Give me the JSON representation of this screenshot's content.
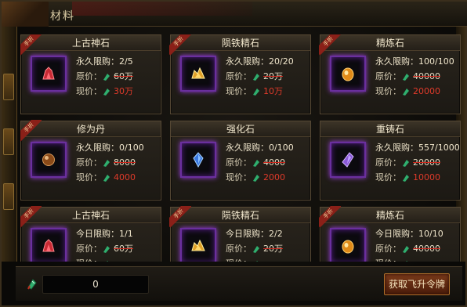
{
  "window": {
    "title": "材料"
  },
  "cards": [
    {
      "name": "上古神石",
      "badge": "手折",
      "limit": "永久限购：2/5",
      "orig_label": "原价：",
      "orig_price": "60万",
      "now_label": "现价：",
      "now_price": "30万",
      "gem": "red-crystal-icon"
    },
    {
      "name": "陨铁精石",
      "badge": "手折",
      "limit": "永久限购：20/20",
      "orig_label": "原价：",
      "orig_price": "20万",
      "now_label": "现价：",
      "now_price": "10万",
      "gem": "gold-ore-icon"
    },
    {
      "name": "精炼石",
      "badge": "手折",
      "limit": "永久限购：100/100",
      "orig_label": "原价：",
      "orig_price": "40000",
      "now_label": "现价：",
      "now_price": "20000",
      "gem": "amber-stone-icon"
    },
    {
      "name": "修为丹",
      "badge": "手折",
      "limit": "永久限购：0/100",
      "orig_label": "原价：",
      "orig_price": "8000",
      "now_label": "现价：",
      "now_price": "4000",
      "gem": "brown-pill-icon"
    },
    {
      "name": "强化石",
      "badge": "",
      "limit": "永久限购：0/100",
      "orig_label": "原价：",
      "orig_price": "4000",
      "now_label": "现价：",
      "now_price": "2000",
      "gem": "blue-crystal-icon"
    },
    {
      "name": "重铸石",
      "badge": "",
      "limit": "永久限购：557/1000",
      "orig_label": "原价：",
      "orig_price": "20000",
      "now_label": "现价：",
      "now_price": "10000",
      "gem": "purple-crystal-icon"
    },
    {
      "name": "上古神石",
      "badge": "手折",
      "limit": "今日限购：1/1",
      "orig_label": "原价：",
      "orig_price": "60万",
      "now_label": "现价：",
      "now_price": "",
      "gem": "red-crystal-icon"
    },
    {
      "name": "陨铁精石",
      "badge": "手折",
      "limit": "今日限购：2/2",
      "orig_label": "原价：",
      "orig_price": "20万",
      "now_label": "现价：",
      "now_price": "",
      "gem": "gold-ore-icon"
    },
    {
      "name": "精炼石",
      "badge": "手折",
      "limit": "今日限购：10/10",
      "orig_label": "原价：",
      "orig_price": "40000",
      "now_label": "现价：",
      "now_price": "",
      "gem": "amber-stone-icon"
    }
  ],
  "footer": {
    "currency_value": "0",
    "acquire_label": "获取飞升令牌"
  },
  "colors": {
    "accent": "#6a2f9e",
    "price_red": "#e03a2a",
    "jade": "#2fae6e"
  }
}
